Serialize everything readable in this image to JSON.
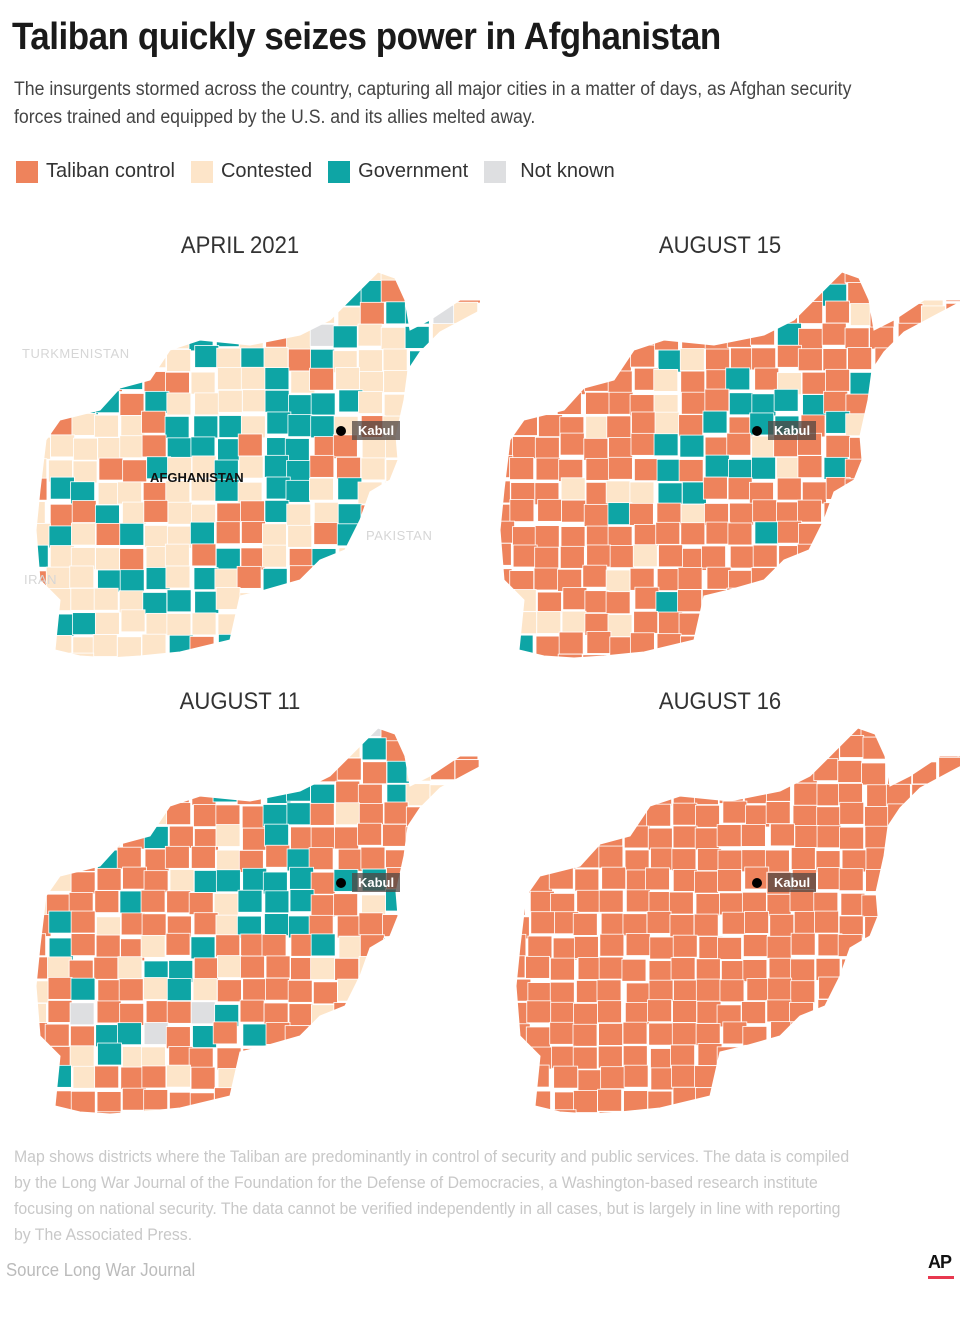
{
  "header": {
    "title": "Taliban quickly seizes power in Afghanistan",
    "subtitle": "The insurgents stormed across the country, capturing all major cities in a matter of days, as Afghan security forces trained and equipped by the U.S. and its allies melted away."
  },
  "legend": [
    {
      "label": "Taliban control",
      "color": "#ee835c"
    },
    {
      "label": "Contested",
      "color": "#fde5c9"
    },
    {
      "label": "Government",
      "color": "#0ea5a5"
    },
    {
      "label": "Not known",
      "color": "#dedfe1"
    }
  ],
  "maps": [
    {
      "title": "APRIL 2021",
      "dominant": "contested",
      "mix": {
        "taliban": 0.25,
        "contested": 0.45,
        "government": 0.27,
        "unknown": 0.03
      }
    },
    {
      "title": "AUGUST 15",
      "dominant": "taliban",
      "mix": {
        "taliban": 0.82,
        "contested": 0.1,
        "government": 0.08,
        "unknown": 0.0
      }
    },
    {
      "title": "AUGUST 11",
      "dominant": "taliban",
      "mix": {
        "taliban": 0.65,
        "contested": 0.18,
        "government": 0.14,
        "unknown": 0.03
      }
    },
    {
      "title": "AUGUST 16",
      "dominant": "taliban",
      "mix": {
        "taliban": 1.0,
        "contested": 0.0,
        "government": 0.0,
        "unknown": 0.0
      }
    }
  ],
  "labels": {
    "kabul": "Kabul",
    "afghanistan": "AFGHANISTAN",
    "turkmenistan": "TURKMENISTAN",
    "iran": "IRAN",
    "pakistan": "PAKISTAN"
  },
  "footer": {
    "note": "Map shows districts where the Taliban are predominantly in control of security and public services. The data is compiled by the Long War Journal of the Foundation for the Defense of Democracies, a Washington-based research institute focusing on national security. The data cannot be verified independently in all cases, but is largely in line with reporting by The Associated Press.",
    "source": "Source  Long War Journal",
    "logo": "AP"
  }
}
